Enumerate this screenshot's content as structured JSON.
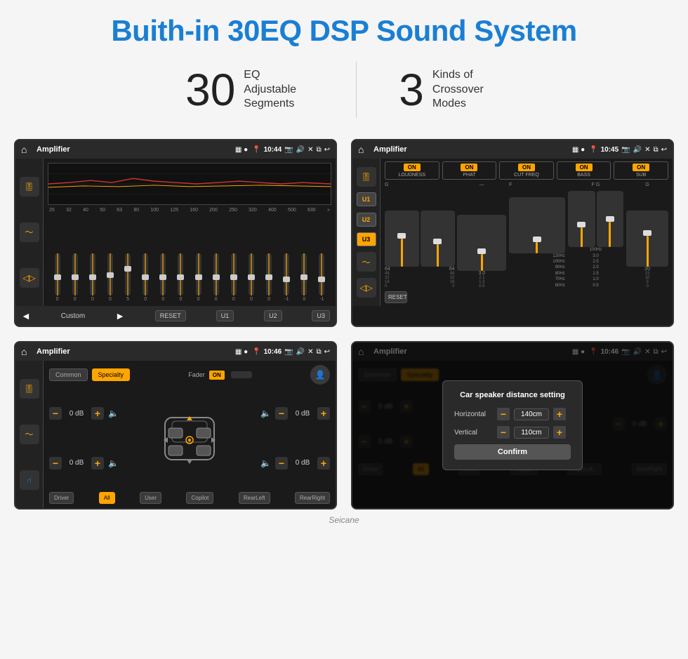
{
  "page": {
    "title": "Buith-in 30EQ DSP Sound System",
    "watermark": "Seicane"
  },
  "stats": {
    "eq_number": "30",
    "eq_label": "EQ Adjustable\nSegments",
    "crossover_number": "3",
    "crossover_label": "Kinds of\nCrossover Modes"
  },
  "screen1": {
    "title": "Amplifier",
    "time": "10:44",
    "frequencies": [
      "25",
      "32",
      "40",
      "50",
      "63",
      "80",
      "100",
      "125",
      "160",
      "200",
      "250",
      "320",
      "400",
      "500",
      "630"
    ],
    "values": [
      "0",
      "0",
      "0",
      "0",
      "5",
      "0",
      "0",
      "0",
      "0",
      "0",
      "0",
      "0",
      "0",
      "-1",
      "0",
      "-1"
    ],
    "preset": "Custom",
    "buttons": {
      "reset": "RESET",
      "u1": "U1",
      "u2": "U2",
      "u3": "U3"
    }
  },
  "screen2": {
    "title": "Amplifier",
    "time": "10:45",
    "presets": [
      "U1",
      "U2",
      "U3"
    ],
    "active_preset": "U3",
    "channels": {
      "loudness": {
        "label": "LOUDNESS",
        "on": true
      },
      "phat": {
        "label": "PHAT",
        "on": true
      },
      "cut_freq": {
        "label": "CUT FREQ",
        "on": true
      },
      "bass": {
        "label": "BASS",
        "on": true
      },
      "sub": {
        "label": "SUB",
        "on": true
      }
    },
    "reset": "RESET"
  },
  "screen3": {
    "title": "Amplifier",
    "time": "10:46",
    "modes": [
      "Common",
      "Specialty"
    ],
    "active_mode": "Specialty",
    "fader_label": "Fader",
    "fader_on": "ON",
    "speaker_rows": [
      {
        "value": "0 dB",
        "position": "front-left"
      },
      {
        "value": "0 dB",
        "position": "front-right"
      },
      {
        "value": "0 dB",
        "position": "rear-left"
      },
      {
        "value": "0 dB",
        "position": "rear-right"
      }
    ],
    "buttons": {
      "driver": "Driver",
      "rear_left": "RearLeft",
      "all": "All",
      "user": "User",
      "copilot": "Copilot",
      "rear_right": "RearRight"
    },
    "active_button": "All"
  },
  "screen4": {
    "title": "Amplifier",
    "time": "10:46",
    "modes": [
      "Common",
      "Specialty"
    ],
    "modal": {
      "title": "Car speaker distance setting",
      "horizontal_label": "Horizontal",
      "horizontal_value": "140cm",
      "vertical_label": "Vertical",
      "vertical_value": "110cm",
      "confirm_label": "Confirm"
    },
    "buttons": {
      "driver": "Driver",
      "rear_left": "RearLef...",
      "all": "All",
      "user": "User",
      "copilot": "Copilot",
      "rear_right": "RearRight"
    },
    "speaker_rows": [
      {
        "value": "0 dB"
      },
      {
        "value": "0 dB"
      }
    ]
  }
}
